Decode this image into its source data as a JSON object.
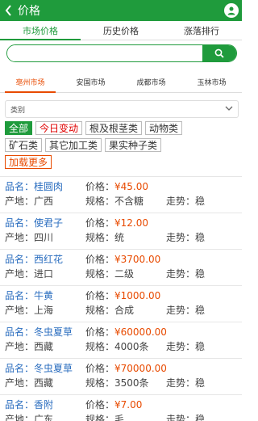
{
  "header": {
    "title": "价格"
  },
  "tabs": [
    {
      "label": "市场价格"
    },
    {
      "label": "历史价格"
    },
    {
      "label": "涨落排行"
    }
  ],
  "search": {
    "placeholder": ""
  },
  "markets": [
    {
      "label": "亳州市场"
    },
    {
      "label": "安国市场"
    },
    {
      "label": "成都市场"
    },
    {
      "label": "玉林市场"
    }
  ],
  "category": {
    "label": "类别"
  },
  "chips": [
    {
      "label": "全部"
    },
    {
      "label": "今日变动"
    },
    {
      "label": "根及根茎类"
    },
    {
      "label": "动物类"
    },
    {
      "label": "矿石类"
    },
    {
      "label": "其它加工类"
    },
    {
      "label": "果实种子类"
    },
    {
      "label": "加载更多"
    }
  ],
  "labels": {
    "name": "品名：",
    "price": "价格：",
    "origin": "产地：",
    "spec": "规格：",
    "trend": "走势："
  },
  "items": [
    {
      "name": "桂圆肉",
      "price": "¥45.00",
      "origin": "广西",
      "spec": "不含糖",
      "trend": "稳"
    },
    {
      "name": "使君子",
      "price": "¥12.00",
      "origin": "四川",
      "spec": "统",
      "trend": "稳"
    },
    {
      "name": "西红花",
      "price": "¥3700.00",
      "origin": "进口",
      "spec": "二级",
      "trend": "稳"
    },
    {
      "name": "牛黄",
      "price": "¥1000.00",
      "origin": "上海",
      "spec": "合成",
      "trend": "稳"
    },
    {
      "name": "冬虫夏草",
      "price": "¥60000.00",
      "origin": "西藏",
      "spec": "4000条",
      "trend": "稳"
    },
    {
      "name": "冬虫夏草",
      "price": "¥70000.00",
      "origin": "西藏",
      "spec": "3500条",
      "trend": "稳"
    },
    {
      "name": "香附",
      "price": "¥7.00",
      "origin": "广东",
      "spec": "毛",
      "trend": "稳"
    }
  ],
  "colors": {
    "brand": "#1f9b3c",
    "accent": "#e84a00",
    "link": "#2a6dbf"
  }
}
